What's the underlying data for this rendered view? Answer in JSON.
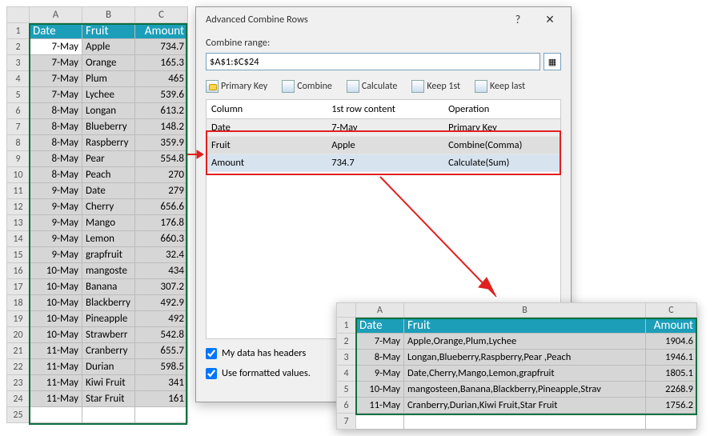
{
  "main_sheet": {
    "col_headers": [
      "A",
      "B",
      "C"
    ],
    "headers": [
      "Date",
      "Fruit",
      "Amount"
    ],
    "rows": [
      {
        "date": "7-May",
        "fruit": "Apple",
        "amount": "734.7"
      },
      {
        "date": "7-May",
        "fruit": "Orange",
        "amount": "165.3"
      },
      {
        "date": "7-May",
        "fruit": "Plum",
        "amount": "465"
      },
      {
        "date": "7-May",
        "fruit": "Lychee",
        "amount": "539.6"
      },
      {
        "date": "8-May",
        "fruit": "Longan",
        "amount": "613.2"
      },
      {
        "date": "8-May",
        "fruit": "Blueberry",
        "amount": "148.2"
      },
      {
        "date": "8-May",
        "fruit": "Raspberry",
        "amount": "359.9"
      },
      {
        "date": "8-May",
        "fruit": "Pear",
        "amount": "554.8"
      },
      {
        "date": "8-May",
        "fruit": "Peach",
        "amount": "270"
      },
      {
        "date": "9-May",
        "fruit": "Date",
        "amount": "279"
      },
      {
        "date": "9-May",
        "fruit": "Cherry",
        "amount": "656.6"
      },
      {
        "date": "9-May",
        "fruit": "Mango",
        "amount": "176.8"
      },
      {
        "date": "9-May",
        "fruit": "Lemon",
        "amount": "660.3"
      },
      {
        "date": "9-May",
        "fruit": "grapfruit",
        "amount": "32.4"
      },
      {
        "date": "10-May",
        "fruit": "mangoste",
        "amount": "434"
      },
      {
        "date": "10-May",
        "fruit": "Banana",
        "amount": "307.2"
      },
      {
        "date": "10-May",
        "fruit": "Blackberry",
        "amount": "492.9"
      },
      {
        "date": "10-May",
        "fruit": "Pineapple",
        "amount": "492"
      },
      {
        "date": "10-May",
        "fruit": "Strawberr",
        "amount": "542.8"
      },
      {
        "date": "11-May",
        "fruit": "Cranberry",
        "amount": "655.7"
      },
      {
        "date": "11-May",
        "fruit": "Durian",
        "amount": "598.5"
      },
      {
        "date": "11-May",
        "fruit": "Kiwi Fruit",
        "amount": "341"
      },
      {
        "date": "11-May",
        "fruit": "Star Fruit",
        "amount": "161"
      }
    ]
  },
  "dialog": {
    "title": "Advanced Combine Rows",
    "help_symbol": "?",
    "close_symbol": "✕",
    "range_label": "Combine range:",
    "range_value": "$A$1:$C$24",
    "toolbar": {
      "primary_key": "Primary Key",
      "combine": "Combine",
      "calculate": "Calculate",
      "keep_first": "Keep 1st",
      "keep_last": "Keep last"
    },
    "cols_header": {
      "column": "Column",
      "first": "1st row content",
      "operation": "Operation"
    },
    "cols_rows": [
      {
        "column": "Date",
        "first": "7-May",
        "operation": "Primary Key"
      },
      {
        "column": "Fruit",
        "first": "Apple",
        "operation": "Combine(Comma)"
      },
      {
        "column": "Amount",
        "first": "734.7",
        "operation": "Calculate(Sum)"
      }
    ],
    "chk_headers": "My data has headers",
    "chk_formatted": "Use formatted values."
  },
  "result_sheet": {
    "col_headers": [
      "A",
      "B",
      "C"
    ],
    "headers": [
      "Date",
      "Fruit",
      "Amount"
    ],
    "rows": [
      {
        "date": "7-May",
        "fruit": "Apple,Orange,Plum,Lychee",
        "amount": "1904.6"
      },
      {
        "date": "8-May",
        "fruit": "Longan,Blueberry,Raspberry,Pear ,Peach",
        "amount": "1946.1"
      },
      {
        "date": "9-May",
        "fruit": "Date,Cherry,Mango,Lemon,grapfruit",
        "amount": "1805.1"
      },
      {
        "date": "10-May",
        "fruit": "mangosteen,Banana,Blackberry,Pineapple,Strav",
        "amount": "2268.9"
      },
      {
        "date": "11-May",
        "fruit": "Cranberry,Durian,Kiwi Fruit,Star Fruit",
        "amount": "1756.2"
      }
    ]
  }
}
